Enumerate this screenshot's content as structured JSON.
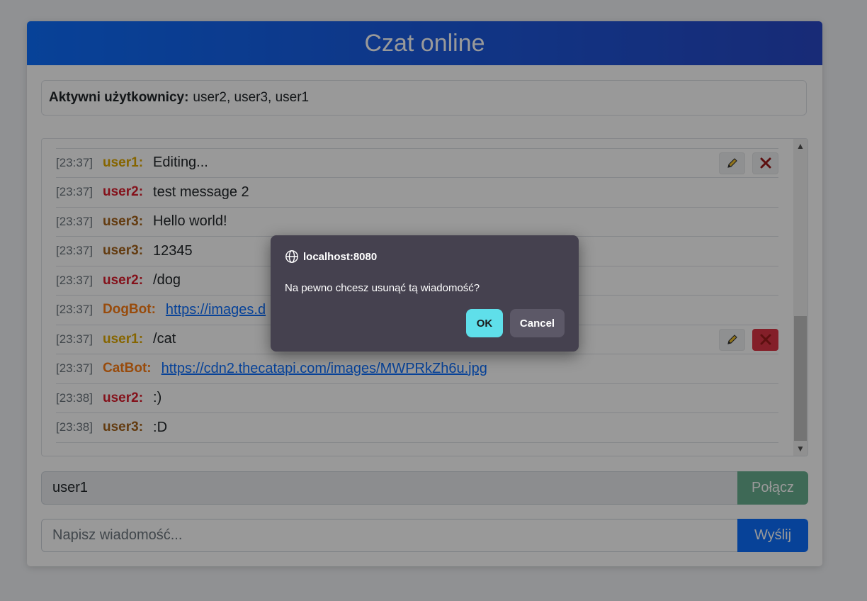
{
  "app": {
    "title": "Czat online"
  },
  "active_users": {
    "label": "Aktywni użytkownicy:",
    "list": "user2, user3, user1"
  },
  "messages": [
    {
      "time": "[23:37]",
      "user": "user1:",
      "text": "Editing...",
      "style": "user1",
      "is_link": false,
      "actions": "normal"
    },
    {
      "time": "[23:37]",
      "user": "user2:",
      "text": "test message 2",
      "style": "user2",
      "is_link": false,
      "actions": ""
    },
    {
      "time": "[23:37]",
      "user": "user3:",
      "text": "Hello world!",
      "style": "user3",
      "is_link": false,
      "actions": ""
    },
    {
      "time": "[23:37]",
      "user": "user3:",
      "text": "12345",
      "style": "user3",
      "is_link": false,
      "actions": ""
    },
    {
      "time": "[23:37]",
      "user": "user2:",
      "text": "/dog",
      "style": "user2",
      "is_link": false,
      "actions": ""
    },
    {
      "time": "[23:37]",
      "user": "DogBot:",
      "text": "https://images.d",
      "style": "dogbot",
      "is_link": true,
      "actions": ""
    },
    {
      "time": "[23:37]",
      "user": "user1:",
      "text": "/cat",
      "style": "user1",
      "is_link": false,
      "actions": "active"
    },
    {
      "time": "[23:37]",
      "user": "CatBot:",
      "text": "https://cdn2.thecatapi.com/images/MWPRkZh6u.jpg",
      "style": "catbot",
      "is_link": true,
      "actions": ""
    },
    {
      "time": "[23:38]",
      "user": "user2:",
      "text": ":)",
      "style": "user2",
      "is_link": false,
      "actions": ""
    },
    {
      "time": "[23:38]",
      "user": "user3:",
      "text": ":D",
      "style": "user3",
      "is_link": false,
      "actions": ""
    }
  ],
  "username_input": {
    "value": "user1"
  },
  "connect_button": {
    "label": "Połącz"
  },
  "message_input": {
    "placeholder": "Napisz wiadomość..."
  },
  "send_button": {
    "label": "Wyślij"
  },
  "dialog": {
    "origin": "localhost:8080",
    "message": "Na pewno chcesz usunąć tą wiadomość?",
    "ok_label": "OK",
    "cancel_label": "Cancel"
  },
  "colors": {
    "header_start": "#0d6efd",
    "header_end": "#2848c6",
    "user1": "#e0a800",
    "user2": "#dc1e2e",
    "user3": "#a5631b",
    "bot": "#fd7e14",
    "ok_button": "#5fdfea"
  }
}
